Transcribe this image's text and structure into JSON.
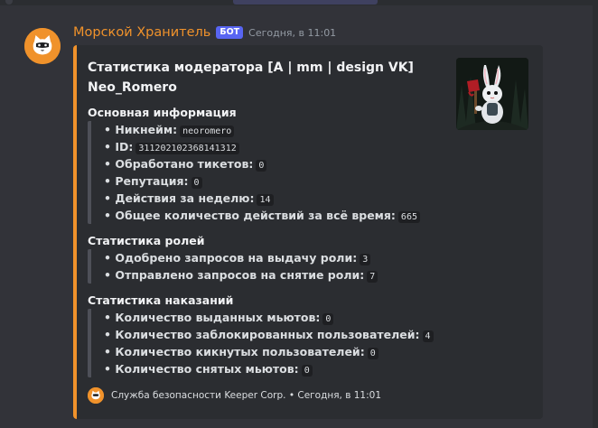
{
  "message": {
    "author": "Морской Хранитель",
    "bot_tag": "БОТ",
    "timestamp": "Сегодня, в 11:01",
    "accent_color": "#f0922b"
  },
  "embed": {
    "title_line1": "Статистика модератора [A | mm | design VK]",
    "title_line2": "Neo_Romero",
    "thumbnail": "white-rabbit-with-red-axe-art",
    "sections": [
      {
        "name": "Основная информация",
        "rows": [
          {
            "label": "• Никнейм:",
            "value": "neoromero"
          },
          {
            "label": "• ID:",
            "value": "311202102368141312"
          },
          {
            "label": "• Обработано тикетов:",
            "value": "0"
          },
          {
            "label": "• Репутация:",
            "value": "0"
          },
          {
            "label": "• Действия за неделю:",
            "value": "14"
          },
          {
            "label": "• Общее количество действий за всё время:",
            "value": "665"
          }
        ]
      },
      {
        "name": "Статистика ролей",
        "rows": [
          {
            "label": "• Одобрено запросов на выдачу роли:",
            "value": "3"
          },
          {
            "label": "• Отправлено запросов на снятие роли:",
            "value": "7"
          }
        ]
      },
      {
        "name": "Статистика наказаний",
        "rows": [
          {
            "label": "• Количество выданных мьютов:",
            "value": "0"
          },
          {
            "label": "• Количество заблокированных пользователей:",
            "value": "4"
          },
          {
            "label": "• Количество кикнутых пользователей:",
            "value": "0"
          },
          {
            "label": "• Количество снятых мьютов:",
            "value": "0"
          }
        ]
      }
    ],
    "footer": {
      "text": "Служба безопасности Keeper Corp.",
      "separator": "•",
      "timestamp": "Сегодня, в 11:01"
    }
  }
}
